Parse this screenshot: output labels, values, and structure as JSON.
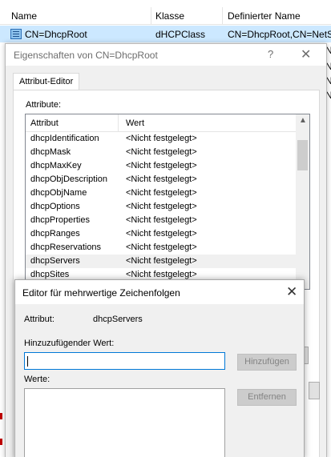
{
  "background_list": {
    "columns": [
      "Name",
      "Klasse",
      "Definierter Name"
    ],
    "row": {
      "name": "CN=DhcpRoot",
      "klasse": "dHCPClass",
      "definierter_name": "CN=DhcpRoot,CN=NetS"
    },
    "side_letters": [
      "N",
      "N",
      "N",
      "N"
    ]
  },
  "properties_dialog": {
    "title": "Eigenschaften von CN=DhcpRoot",
    "help_glyph": "?",
    "close_glyph": "✕",
    "tab_label": "Attribut-Editor",
    "attributes_label": "Attribute:",
    "list_header": {
      "attribute": "Attribut",
      "value": "Wert"
    },
    "rows": [
      {
        "name": "dhcpIdentification",
        "value": "<Nicht festgelegt>"
      },
      {
        "name": "dhcpMask",
        "value": "<Nicht festgelegt>"
      },
      {
        "name": "dhcpMaxKey",
        "value": "<Nicht festgelegt>"
      },
      {
        "name": "dhcpObjDescription",
        "value": "<Nicht festgelegt>"
      },
      {
        "name": "dhcpObjName",
        "value": "<Nicht festgelegt>"
      },
      {
        "name": "dhcpOptions",
        "value": "<Nicht festgelegt>"
      },
      {
        "name": "dhcpProperties",
        "value": "<Nicht festgelegt>"
      },
      {
        "name": "dhcpRanges",
        "value": "<Nicht festgelegt>"
      },
      {
        "name": "dhcpReservations",
        "value": "<Nicht festgelegt>"
      },
      {
        "name": "dhcpServers",
        "value": "<Nicht festgelegt>"
      },
      {
        "name": "dhcpSites",
        "value": "<Nicht festgelegt>"
      }
    ],
    "selected_row": "dhcpServers",
    "scroll_up_glyph": "▲"
  },
  "editor_dialog": {
    "title": "Editor für mehrwertige Zeichenfolgen",
    "close_glyph": "✕",
    "attribute_label": "Attribut:",
    "attribute_value": "dhcpServers",
    "add_value_label": "Hinzuzufügender Wert:",
    "add_value_input": "",
    "add_button": "Hinzufügen",
    "values_label": "Werte:",
    "remove_button": "Entfernen"
  }
}
